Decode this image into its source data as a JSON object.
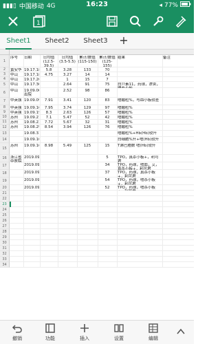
{
  "status": {
    "carrier": "中国移动",
    "network": "4G",
    "time": "16:23",
    "battery": "77%"
  },
  "toolbar": {
    "close": "close-icon",
    "sheets_count": "1",
    "save": "save-icon",
    "search": "search-icon",
    "tools": "wrench-icon",
    "edit": "pen-icon"
  },
  "tabs": [
    "Sheet1",
    "Sheet2",
    "Sheet3"
  ],
  "active_tab": "Sheet1",
  "grid": {
    "row_numbers": [
      "1",
      "2",
      "3",
      "4",
      "5",
      "6",
      "7",
      "8",
      "9",
      "10",
      "11",
      "12",
      "13",
      "14",
      "15",
      "16",
      "17",
      "18",
      "19",
      "20",
      "21",
      "22",
      "23",
      "24",
      "25",
      "26",
      "27",
      "28",
      "29",
      "30",
      "31",
      "32",
      "33",
      "34"
    ],
    "header": [
      "序号",
      "日期",
      "日均值(12.5-39.5)",
      "日均值(3.5-5.5)",
      "累计/数值(115-150)",
      "累计/数值(125-155)",
      "结果",
      "备注"
    ],
    "rows": [
      [
        "黄安华拉",
        "19.17.18",
        "5.8",
        "3.28",
        "133",
        "70",
        "",
        ""
      ],
      [
        "中山",
        "19.17.18",
        "4.75",
        "3.27",
        "14",
        "14",
        "",
        ""
      ],
      [
        "中山",
        "19.17.26",
        "",
        "1",
        "15",
        "7",
        "",
        ""
      ],
      [
        "中山",
        "19.17.30",
        "",
        "2.64",
        "91",
        "75",
        "白介素11，药球，渗卖，嗜血小板",
        ""
      ],
      [
        "中山",
        "19.09.00 出院",
        "",
        "2.52",
        "98",
        "86",
        "",
        ""
      ],
      [
        "中英强",
        "19.09.09",
        "7.91",
        "3.41",
        "120",
        "83",
        "嗜酸粒%，与血小板较差",
        ""
      ],
      [
        "中英强",
        "19.09.16",
        "7.95",
        "3.74",
        "129",
        "97",
        "嗜酸粒%",
        ""
      ],
      [
        "中英强",
        "19.09.19",
        "8.3",
        "2.63",
        "126",
        "57",
        "嗜酸粒%",
        ""
      ],
      [
        "苏州",
        "19.09.21",
        "7.1",
        "5.47",
        "52",
        "42",
        "嗜酸粒%",
        ""
      ],
      [
        "苏州",
        "19.08.23",
        "7.72",
        "5.67",
        "32",
        "31",
        "嗜酸粒%",
        ""
      ],
      [
        "苏州",
        "19.08.29",
        "8.54",
        "3.94",
        "126",
        "76",
        "嗜酸粒%",
        ""
      ],
      [
        "",
        "19.08.31",
        "",
        "",
        "",
        "",
        "嗜酸粒%+Hb(Hb)较升",
        ""
      ],
      [
        "",
        "19.09.10",
        "",
        "",
        "",
        "",
        "白细胞%升+嗜(Hb)较升",
        ""
      ],
      [
        "苏州",
        "19.09.16",
        "8.98",
        "5.49",
        "125",
        "15",
        "T淋巴胞数 嗜(Hb)较升",
        ""
      ],
      [
        "浙江省中医院中医",
        "2019.09.23",
        "",
        "",
        "",
        "",
        "TPO，真杀小板+，利可君",
        ""
      ],
      [
        "",
        "2019.09.24",
        "",
        "",
        "",
        "",
        "TPO，药球，嗜血，艾，真杀小板+，利可君",
        ""
      ],
      [
        "",
        "2019.09.26",
        "",
        "",
        "",
        "",
        "TPO，药球，真杀小板+，利可君",
        ""
      ],
      [
        "",
        "2019.09.28",
        "",
        "",
        "",
        "",
        "TPO，药球，嗜杀小板+，利可君",
        ""
      ],
      [
        "",
        "2019.09.30",
        "",
        "",
        "",
        "",
        "TPO，药球，嗜杀小板+，利可君",
        ""
      ]
    ],
    "row_values": [
      "",
      "",
      "",
      "",
      "",
      "",
      "",
      "",
      "",
      "",
      "",
      "",
      "",
      "",
      "5",
      "34",
      "37",
      "54",
      "52"
    ]
  },
  "bottom": [
    {
      "icon": "undo-icon",
      "label": "撤销"
    },
    {
      "icon": "function-icon",
      "label": "功能"
    },
    {
      "icon": "insert-icon",
      "label": "插入"
    },
    {
      "icon": "format-icon",
      "label": "设置"
    },
    {
      "icon": "table-icon",
      "label": "编辑"
    },
    {
      "icon": "expand-icon",
      "label": ""
    }
  ]
}
